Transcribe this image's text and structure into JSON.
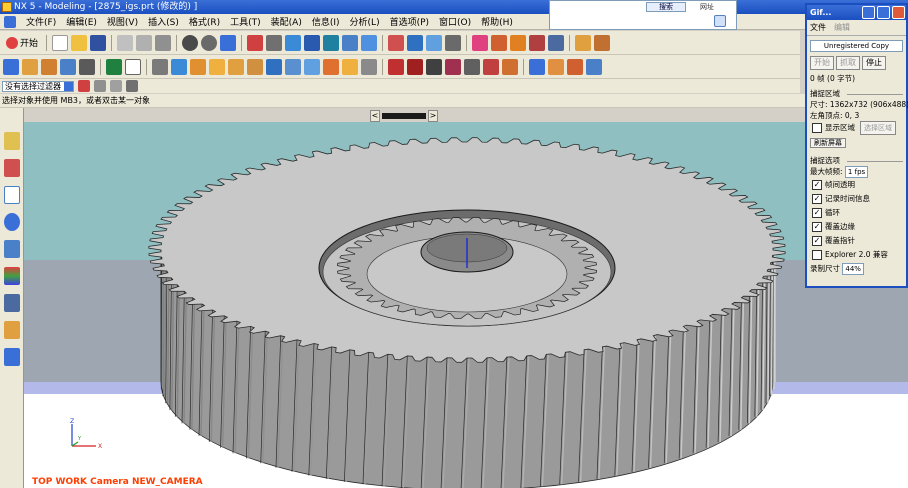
{
  "window": {
    "title": "NX 5 - Modeling - [2875_igs.prt  (修改的)  ]"
  },
  "menu": [
    "文件(F)",
    "编辑(E)",
    "视图(V)",
    "插入(S)",
    "格式(R)",
    "工具(T)",
    "装配(A)",
    "信息(I)",
    "分析(L)",
    "首选项(P)",
    "窗口(O)",
    "帮助(H)"
  ],
  "toolbar": {
    "start_label": "开始"
  },
  "filter": {
    "selected": "没有选择过滤器"
  },
  "status": {
    "prompt": "选择对象并使用 MB3，或者双击某一对象"
  },
  "browser": {
    "search_label": "搜索",
    "link_label": "网址"
  },
  "gifcam": {
    "title": "Gif...",
    "menu": [
      "文件",
      "编辑"
    ],
    "unregistered": "Unregistered Copy",
    "buttons": {
      "start": "开始",
      "capture": "抓取",
      "stop": "停止"
    },
    "frames": "0 帧 (0 字节)",
    "capture_area_label": "捕捉区域",
    "size_line": "尺寸: 1362x732 (906x488)",
    "corner_line": "左角顶点:      0, 3",
    "show_area": "显示区域",
    "select_area": "选择区域",
    "refresh": "刷新屏幕",
    "options_label": "捕捉选项",
    "max_fps_label": "最大帧频:",
    "max_fps_value": "1 fps",
    "options": [
      {
        "label": "帧间透明",
        "checked": true
      },
      {
        "label": "记录时间信息",
        "checked": true
      },
      {
        "label": "循环",
        "checked": true
      },
      {
        "label": "覆盖边缘",
        "checked": true
      },
      {
        "label": "覆盖指针",
        "checked": true
      },
      {
        "label": "Explorer 2.0 兼容",
        "checked": false
      }
    ],
    "record_size_label": "录制尺寸",
    "record_size_value": "44%"
  },
  "viewport": {
    "camera_label": "TOP WORK Camera NEW_CAMERA",
    "axes": {
      "x": "X",
      "y": "Y",
      "z": "Z"
    }
  },
  "colors": {
    "title_blue": "#1b4fc0",
    "viewport_teal": "#8fbfc0",
    "gear_gray": "#c8c8c8",
    "camera_label_orange": "#ff3d00"
  }
}
